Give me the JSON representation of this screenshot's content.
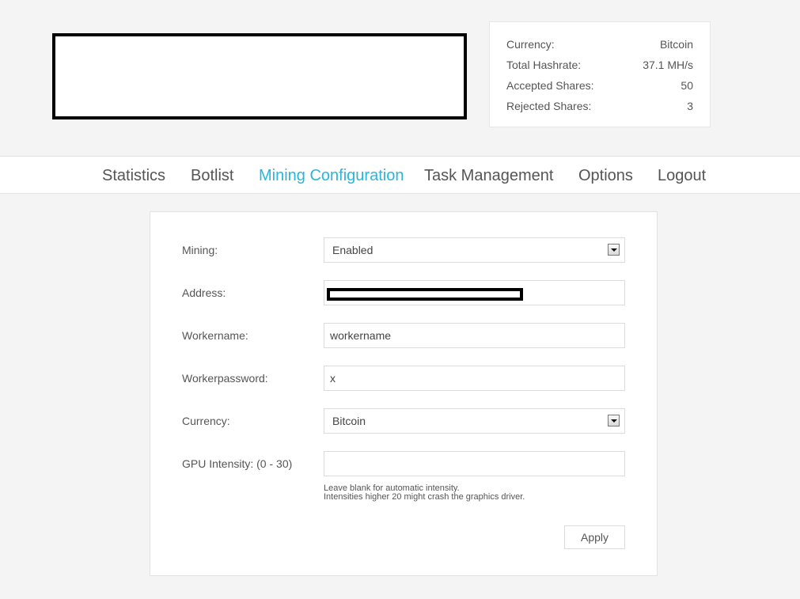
{
  "stats": {
    "currency_label": "Currency:",
    "currency_value": "Bitcoin",
    "hashrate_label": "Total Hashrate:",
    "hashrate_value": "37.1 MH/s",
    "accepted_label": "Accepted Shares:",
    "accepted_value": "50",
    "rejected_label": "Rejected Shares:",
    "rejected_value": "3"
  },
  "nav": {
    "statistics": "Statistics",
    "botlist": "Botlist",
    "mining_configuration": "Mining Configuration",
    "task_management": "Task Management",
    "options": "Options",
    "logout": "Logout",
    "active_color": "#29b6d8"
  },
  "form": {
    "mining_label": "Mining:",
    "mining_value": "Enabled",
    "address_label": "Address:",
    "workername_label": "Workername:",
    "workername_value": "workername",
    "workerpassword_label": "Workerpassword:",
    "workerpassword_value": "x",
    "currency_label": "Currency:",
    "currency_value": "Bitcoin",
    "gpu_label": "GPU Intensity: (0 - 30)",
    "gpu_value": "",
    "help_line1": "Leave blank for automatic intensity.",
    "help_line2": "Intensities higher 20 might crash the graphics driver.",
    "apply_label": "Apply"
  }
}
